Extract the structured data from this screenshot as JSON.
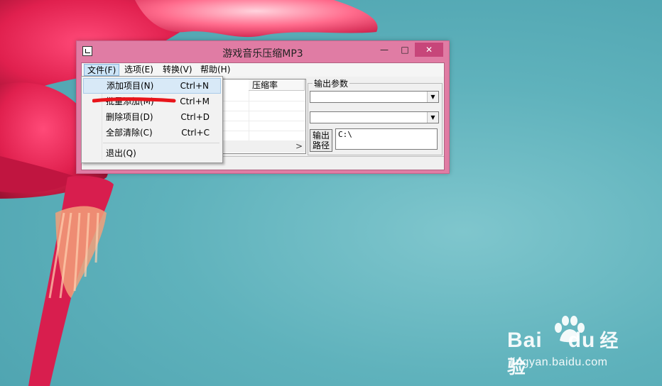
{
  "window": {
    "title": "游戏音乐压缩MP3",
    "min_glyph": "—",
    "max_glyph": "□",
    "close_glyph": "✕"
  },
  "menubar": {
    "file": "文件(F)",
    "options": "选项(E)",
    "convert": "转换(V)",
    "help": "帮助(H)"
  },
  "file_menu": {
    "items": [
      {
        "label": "添加项目(N)",
        "shortcut": "Ctrl+N"
      },
      {
        "label": "批量添加(M)",
        "shortcut": "Ctrl+M"
      },
      {
        "label": "删除项目(D)",
        "shortcut": "Ctrl+D"
      },
      {
        "label": "全部清除(C)",
        "shortcut": "Ctrl+C"
      },
      {
        "label": "退出(Q)",
        "shortcut": ""
      }
    ]
  },
  "list": {
    "columns": [
      "压缩率"
    ],
    "scroll_right_glyph": ">"
  },
  "output_params": {
    "group_label": "输出参数",
    "combo1_value": "",
    "combo2_value": "",
    "path_button": "输出路径",
    "path_button_line1": "输出",
    "path_button_line2": "路径",
    "path_value": "C:\\"
  },
  "watermark": {
    "logo_a": "Bai",
    "logo_b": "du",
    "logo_c": "经验",
    "site": "jingyan.baidu.com"
  },
  "colors": {
    "window_frame": "#e07ca4",
    "close_button": "#c7467a",
    "highlight": "#d8e9f7",
    "annotation": "#e8151b",
    "desktop": "#5fb2bc"
  }
}
